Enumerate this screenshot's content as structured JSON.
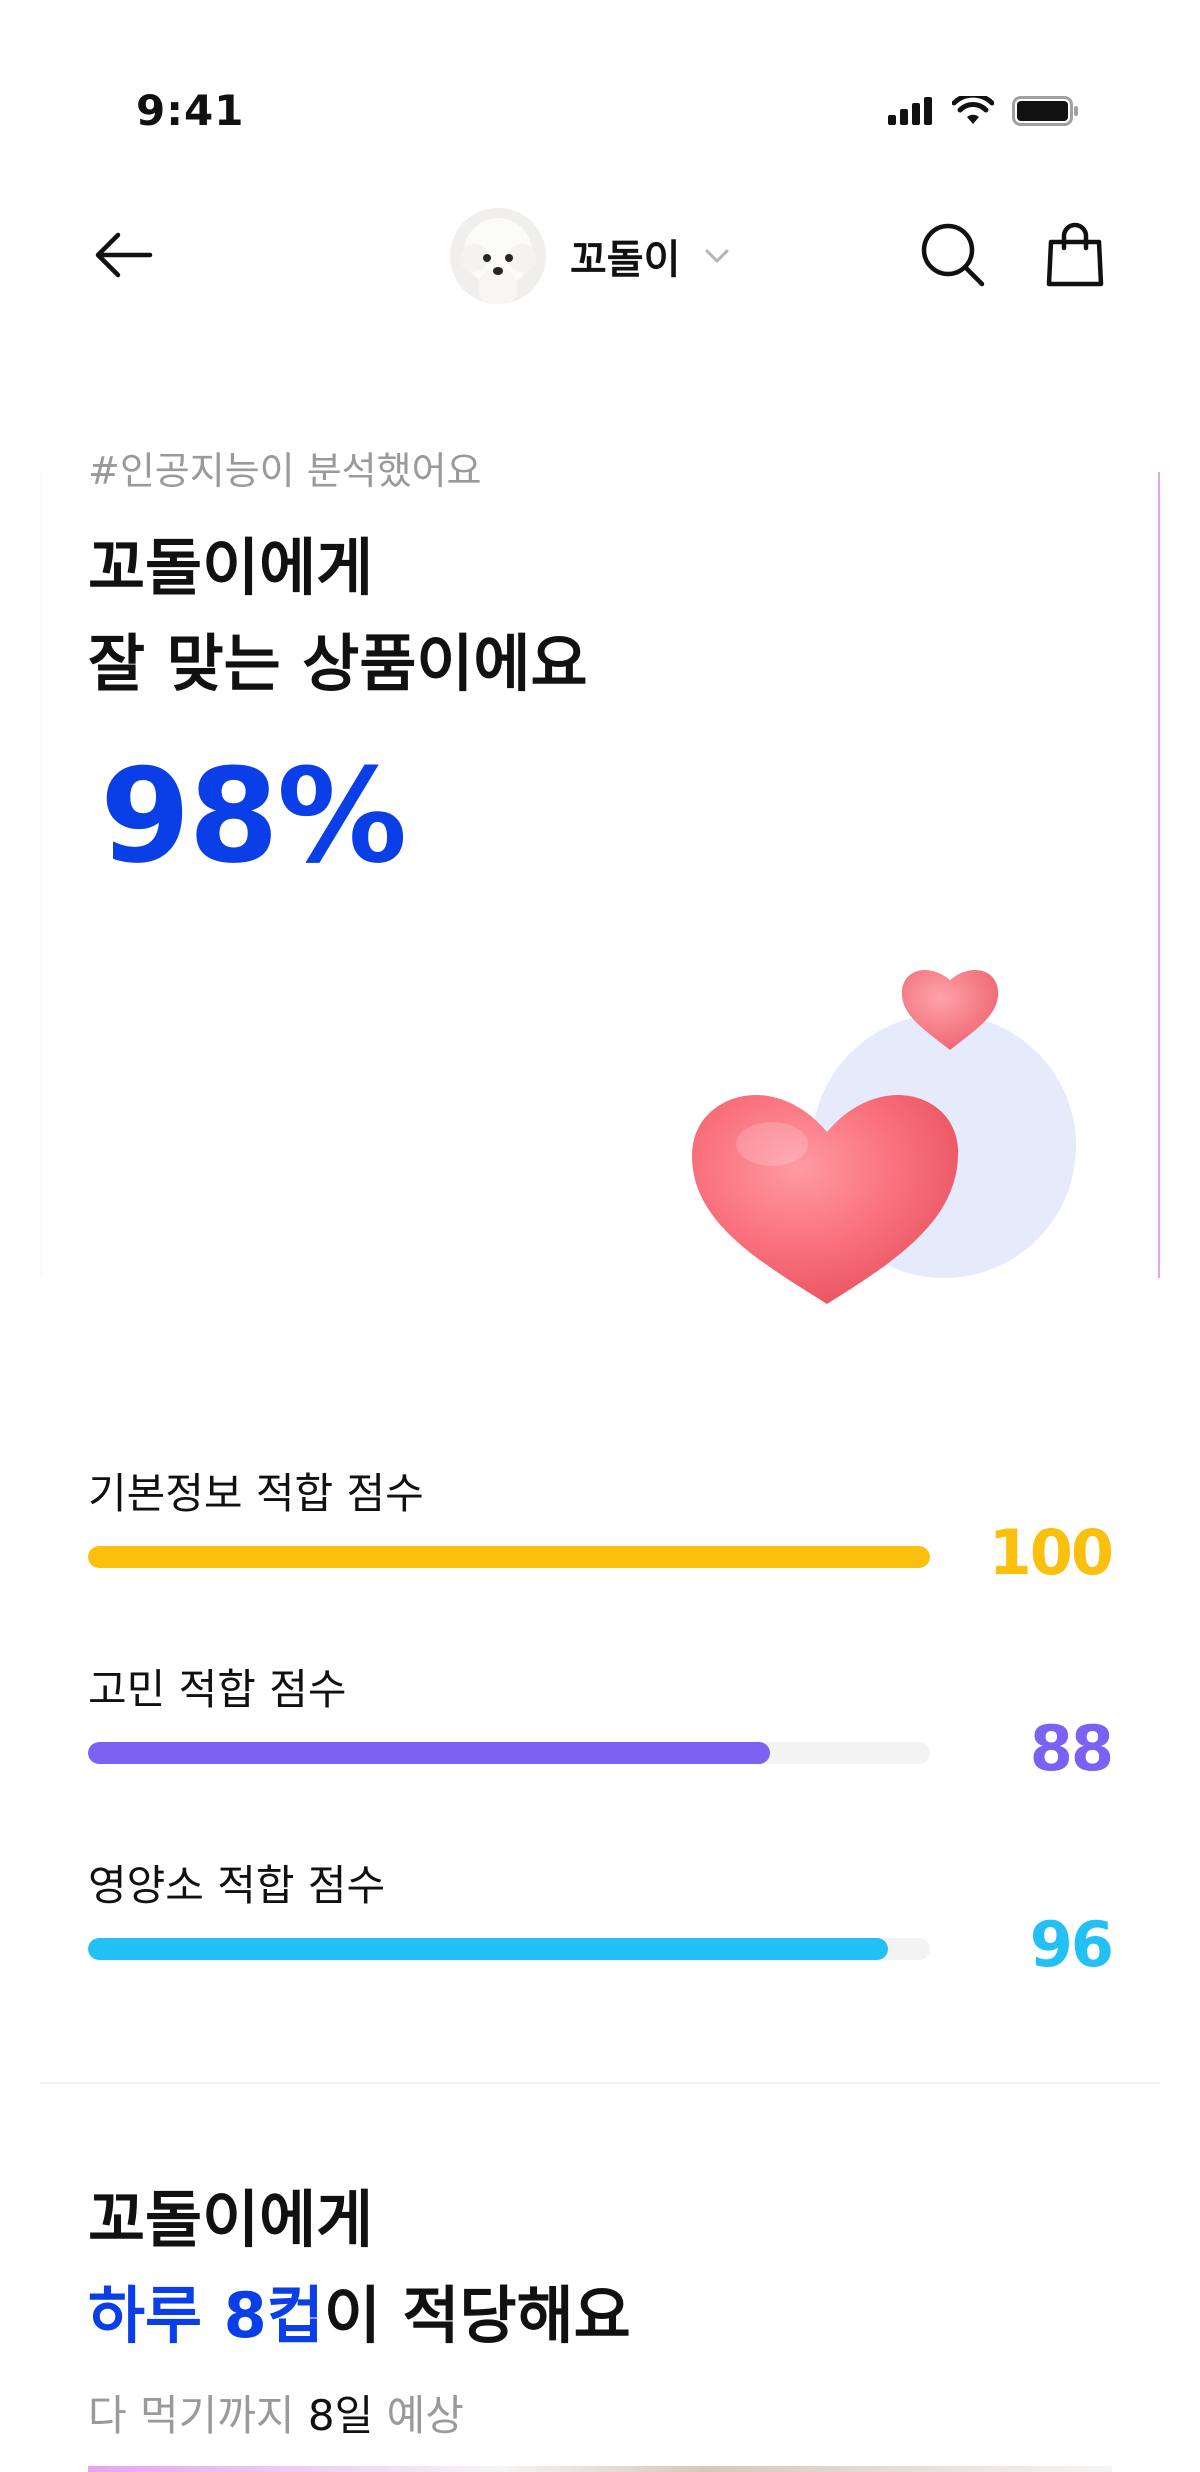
{
  "status_bar": {
    "time": "9:41"
  },
  "header": {
    "pet_name": "꼬돌이"
  },
  "hero": {
    "hashtag": "#인공지능이 분석했어요",
    "title_line1": "꼬돌이에게",
    "title_line2": "잘 맞는 상품이에요",
    "match_percent": "98%"
  },
  "scores": [
    {
      "label": "기본정보 적합 점수",
      "value": "100",
      "fraction": 1.0,
      "color": "#fbbf0e"
    },
    {
      "label": "고민 적합 점수",
      "value": "88",
      "fraction": 0.81,
      "color": "#7b61f4"
    },
    {
      "label": "영양소 적합 점수",
      "value": "96",
      "fraction": 0.95,
      "color": "#22c0f5"
    }
  ],
  "recommendation": {
    "line1": "꼬돌이에게",
    "line2_accent": "하루 8컵",
    "line2_rest": "이 적당해요",
    "sub_prefix": "다 먹기까지 ",
    "sub_strong": "8일",
    "sub_suffix": " 예상"
  },
  "icons": {
    "back": "arrow-left-icon",
    "dropdown": "chevron-down-icon",
    "search": "search-icon",
    "cart": "shopping-bag-icon"
  },
  "colors": {
    "accent_blue": "#0a3ee6"
  }
}
